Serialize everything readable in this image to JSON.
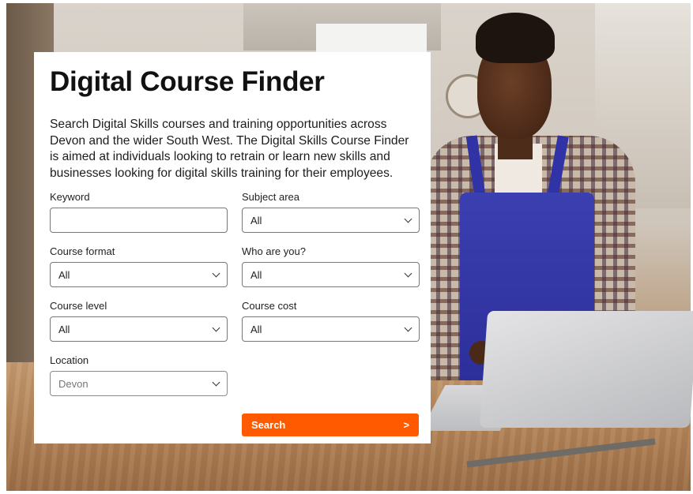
{
  "card": {
    "title": "Digital Course Finder",
    "intro": "Search Digital Skills courses and training opportunities across Devon and the wider South West. The Digital Skills Course Finder is aimed at individuals looking to retrain or learn new skills and businesses looking for digital skills training for their employees."
  },
  "form": {
    "keyword": {
      "label": "Keyword",
      "value": ""
    },
    "subject_area": {
      "label": "Subject area",
      "value": "All"
    },
    "course_format": {
      "label": "Course format",
      "value": "All"
    },
    "who_are_you": {
      "label": "Who are you?",
      "value": "All"
    },
    "course_level": {
      "label": "Course level",
      "value": "All"
    },
    "course_cost": {
      "label": "Course cost",
      "value": "All"
    },
    "location": {
      "label": "Location",
      "value": "Devon"
    },
    "search_button": {
      "label": "Search",
      "arrow": ">"
    }
  },
  "colors": {
    "accent": "#ff5a00",
    "apron": "#2c2f9a",
    "card_bg": "#ffffff"
  }
}
